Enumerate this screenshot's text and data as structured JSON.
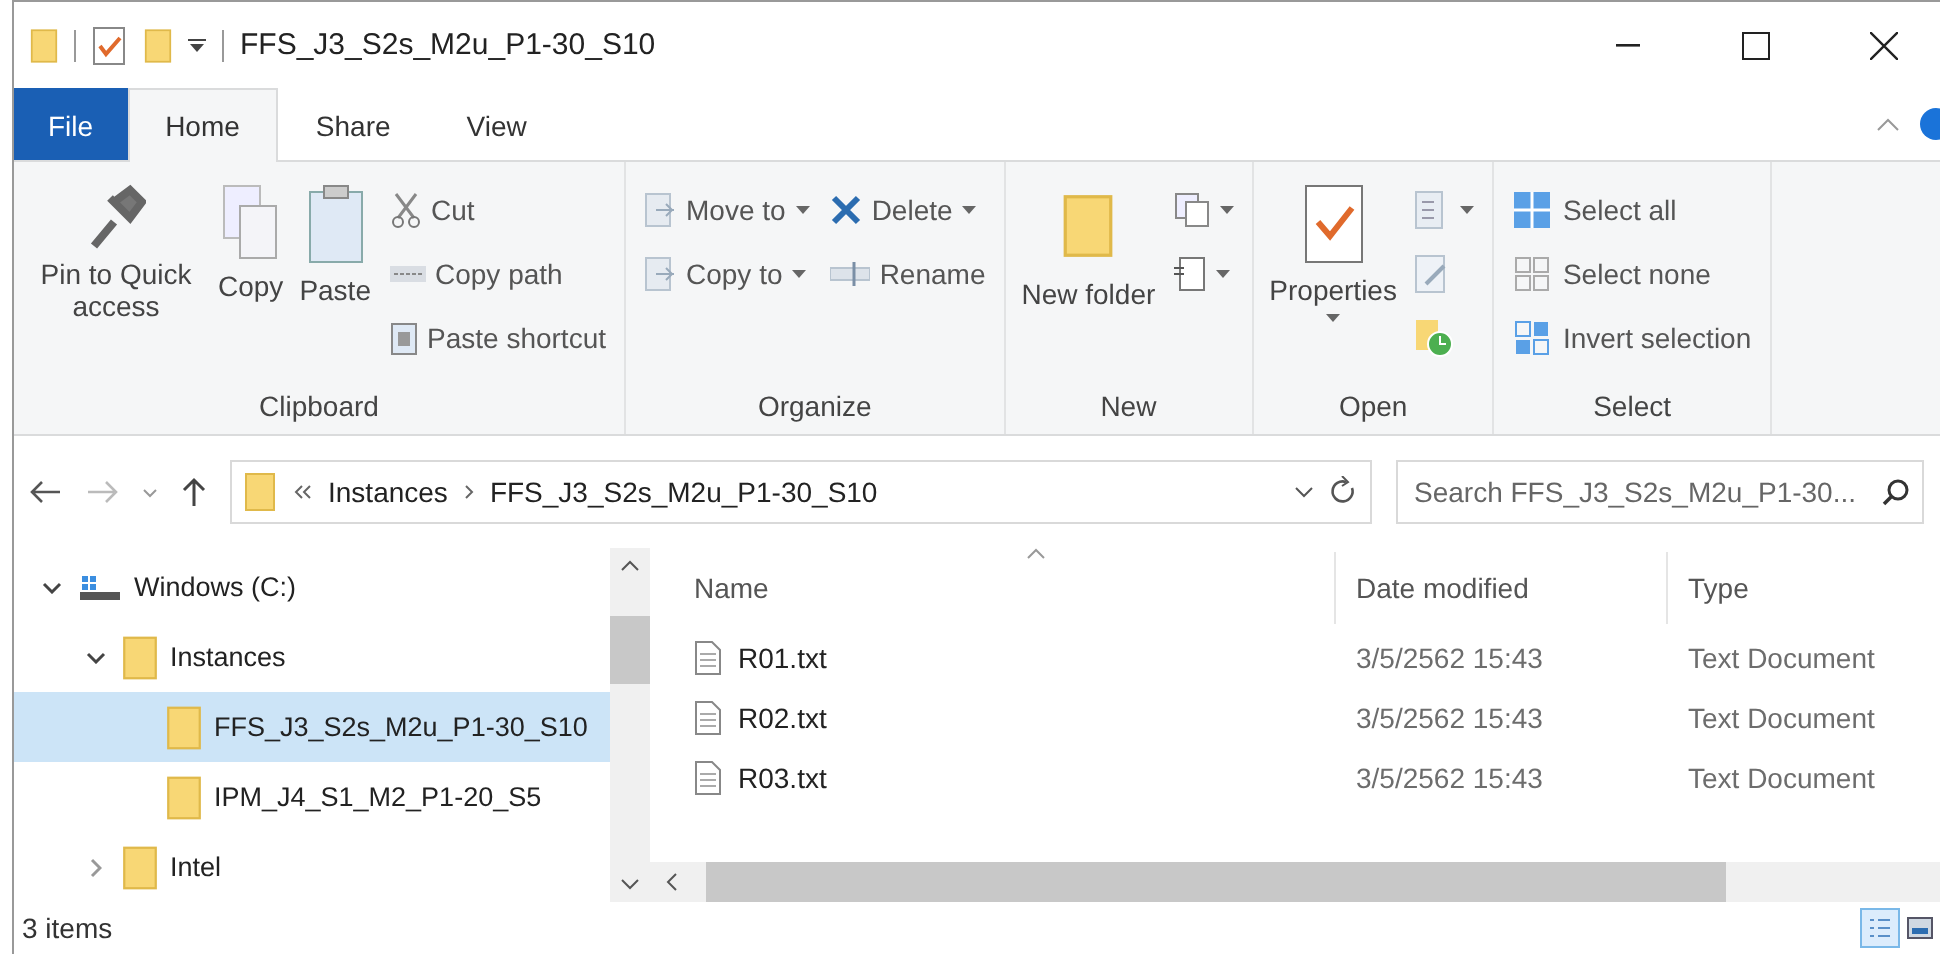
{
  "window": {
    "title": "FFS_J3_S2s_M2u_P1-30_S10"
  },
  "tabs": [
    {
      "label": "File",
      "kind": "file",
      "selected": false
    },
    {
      "label": "Home",
      "kind": "tab",
      "selected": true
    },
    {
      "label": "Share",
      "kind": "tab",
      "selected": false
    },
    {
      "label": "View",
      "kind": "tab",
      "selected": false
    }
  ],
  "ribbon": {
    "groups": [
      {
        "label": "Clipboard",
        "columns": [
          {
            "kind": "large",
            "items": [
              {
                "label": "Pin to Quick access",
                "dropdown": false
              }
            ]
          },
          {
            "kind": "large",
            "items": [
              {
                "label": "Copy",
                "dropdown": false
              }
            ]
          },
          {
            "kind": "large",
            "items": [
              {
                "label": "Paste",
                "dropdown": false
              }
            ]
          },
          {
            "kind": "stack",
            "items": [
              {
                "label": "Cut",
                "dropdown": false
              },
              {
                "label": "Copy path",
                "dropdown": false
              },
              {
                "label": "Paste shortcut",
                "dropdown": false
              }
            ]
          }
        ]
      },
      {
        "label": "Organize",
        "columns": [
          {
            "kind": "stack",
            "items": [
              {
                "label": "Move to",
                "dropdown": true
              },
              {
                "label": "Copy to",
                "dropdown": true
              }
            ]
          },
          {
            "kind": "stack",
            "items": [
              {
                "label": "Delete",
                "dropdown": true
              },
              {
                "label": "Rename",
                "dropdown": false
              }
            ]
          }
        ]
      },
      {
        "label": "New",
        "columns": [
          {
            "kind": "large",
            "items": [
              {
                "label": "New folder",
                "dropdown": false
              }
            ]
          },
          {
            "kind": "stack",
            "items": [
              {
                "dropdown": true
              },
              {
                "dropdown": true
              }
            ]
          }
        ]
      },
      {
        "label": "Open",
        "columns": [
          {
            "kind": "large",
            "items": [
              {
                "label": "Properties",
                "dropdown": true
              }
            ]
          },
          {
            "kind": "stack",
            "items": [
              {
                "dropdown": true
              },
              {
                "dropdown": false
              },
              {
                "dropdown": false
              }
            ]
          }
        ]
      },
      {
        "label": "Select",
        "columns": [
          {
            "kind": "stack",
            "items": [
              {
                "label": "Select all",
                "dropdown": false
              },
              {
                "label": "Select none",
                "dropdown": false
              },
              {
                "label": "Invert selection",
                "dropdown": false
              }
            ]
          }
        ]
      }
    ]
  },
  "address": {
    "path": [
      "Instances",
      "FFS_J3_S2s_M2u_P1-30_S10"
    ]
  },
  "search": {
    "placeholder": "Search FFS_J3_S2s_M2u_P1-30..."
  },
  "sidebar": {
    "items": [
      {
        "label": "Windows (C:)",
        "kind": "drive",
        "expanded": true,
        "selected": false,
        "children": [
          {
            "label": "Instances",
            "kind": "folder",
            "expanded": true,
            "selected": false,
            "children": [
              {
                "label": "FFS_J3_S2s_M2u_P1-30_S10",
                "kind": "folder",
                "selected": true
              },
              {
                "label": "IPM_J4_S1_M2_P1-20_S5",
                "kind": "folder",
                "selected": false
              }
            ]
          },
          {
            "label": "Intel",
            "kind": "folder",
            "expanded": false,
            "selected": false
          }
        ]
      }
    ]
  },
  "table": {
    "columns": [
      "Name",
      "Date modified",
      "Type"
    ],
    "rows": [
      {
        "name": "R01.txt",
        "date": "3/5/2562 15:43",
        "type": "Text Document"
      },
      {
        "name": "R02.txt",
        "date": "3/5/2562 15:43",
        "type": "Text Document"
      },
      {
        "name": "R03.txt",
        "date": "3/5/2562 15:43",
        "type": "Text Document"
      }
    ]
  },
  "status_bar": {
    "text": "3 items",
    "views": [
      {
        "selected": true
      },
      {
        "selected": false
      }
    ]
  }
}
